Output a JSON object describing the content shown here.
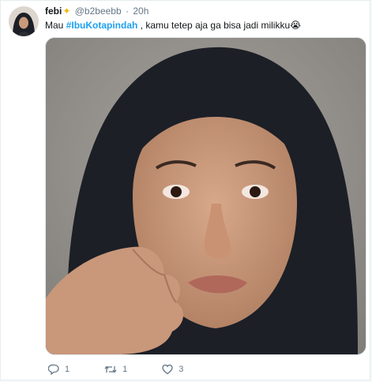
{
  "tweet": {
    "author_name": "febi",
    "author_handle": "@b2beebb",
    "separator": "·",
    "time": "20h",
    "text_before": "Mau ",
    "hashtag": "#IbuKotapindah",
    "text_after": " , kamu tetep aja ga bisa jadi milikku",
    "emoji": "😭"
  },
  "actions": {
    "replies": "1",
    "retweets": "1",
    "likes": "3"
  },
  "colors": {
    "link": "#1da1f2",
    "muted": "#657786",
    "hijab": "#1c1f26"
  },
  "icons": [
    "sparkles-icon",
    "reply-icon",
    "retweet-icon",
    "like-icon"
  ]
}
